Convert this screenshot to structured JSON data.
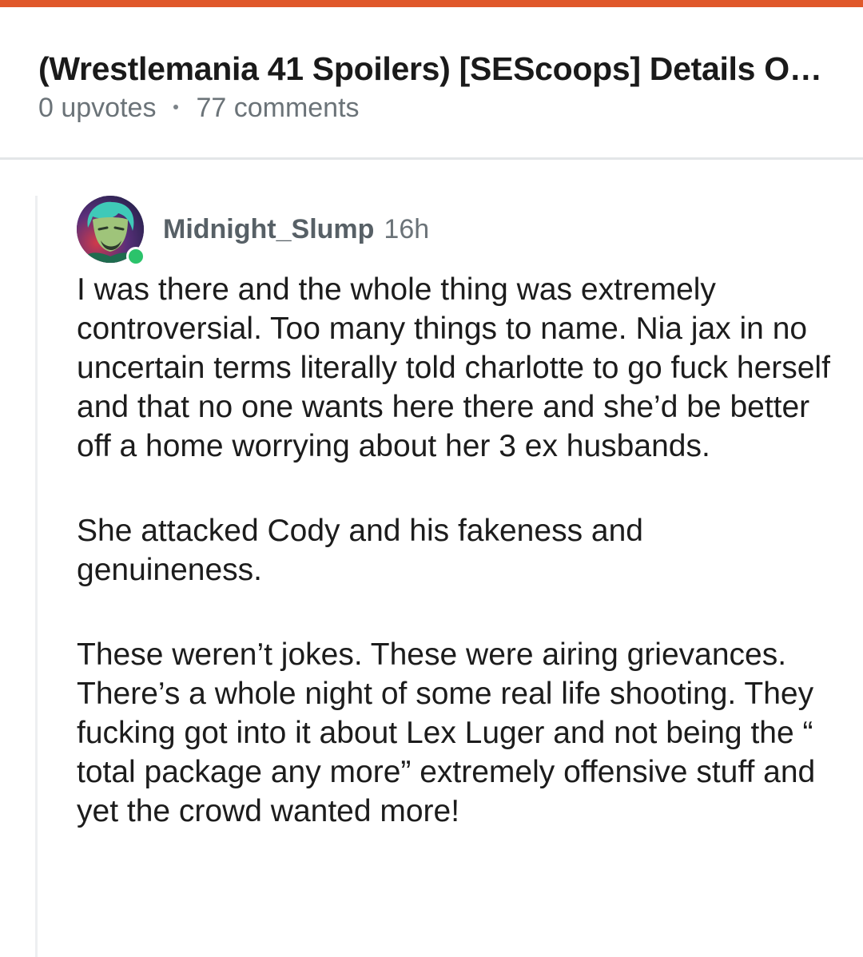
{
  "post": {
    "title": "(Wrestlemania 41 Spoilers) [SEScoops] Details On...",
    "upvotes": "0 upvotes",
    "comments": "77 comments"
  },
  "comment": {
    "author": "Midnight_Slump",
    "time": "16h",
    "avatar_icon": "user-avatar-icon",
    "online": true,
    "paragraphs": [
      "I was there and the whole thing was extremely controversial. Too many things to name. Nia jax in no uncertain terms literally told charlotte to go fuck herself and that no one wants here there and she’d be better off a home worrying about her 3 ex husbands.",
      "She attacked Cody and his fakeness and genuineness.",
      "These weren’t jokes. These were airing grievances. There’s a whole night of some real life shooting. They fucking got into it about Lex Luger and not being the “ total package any more” extremely offensive stuff and yet the crowd wanted more!"
    ]
  },
  "colors": {
    "accent": "#e0582a",
    "online": "#2bc36b",
    "meta_text": "#6b7378"
  }
}
